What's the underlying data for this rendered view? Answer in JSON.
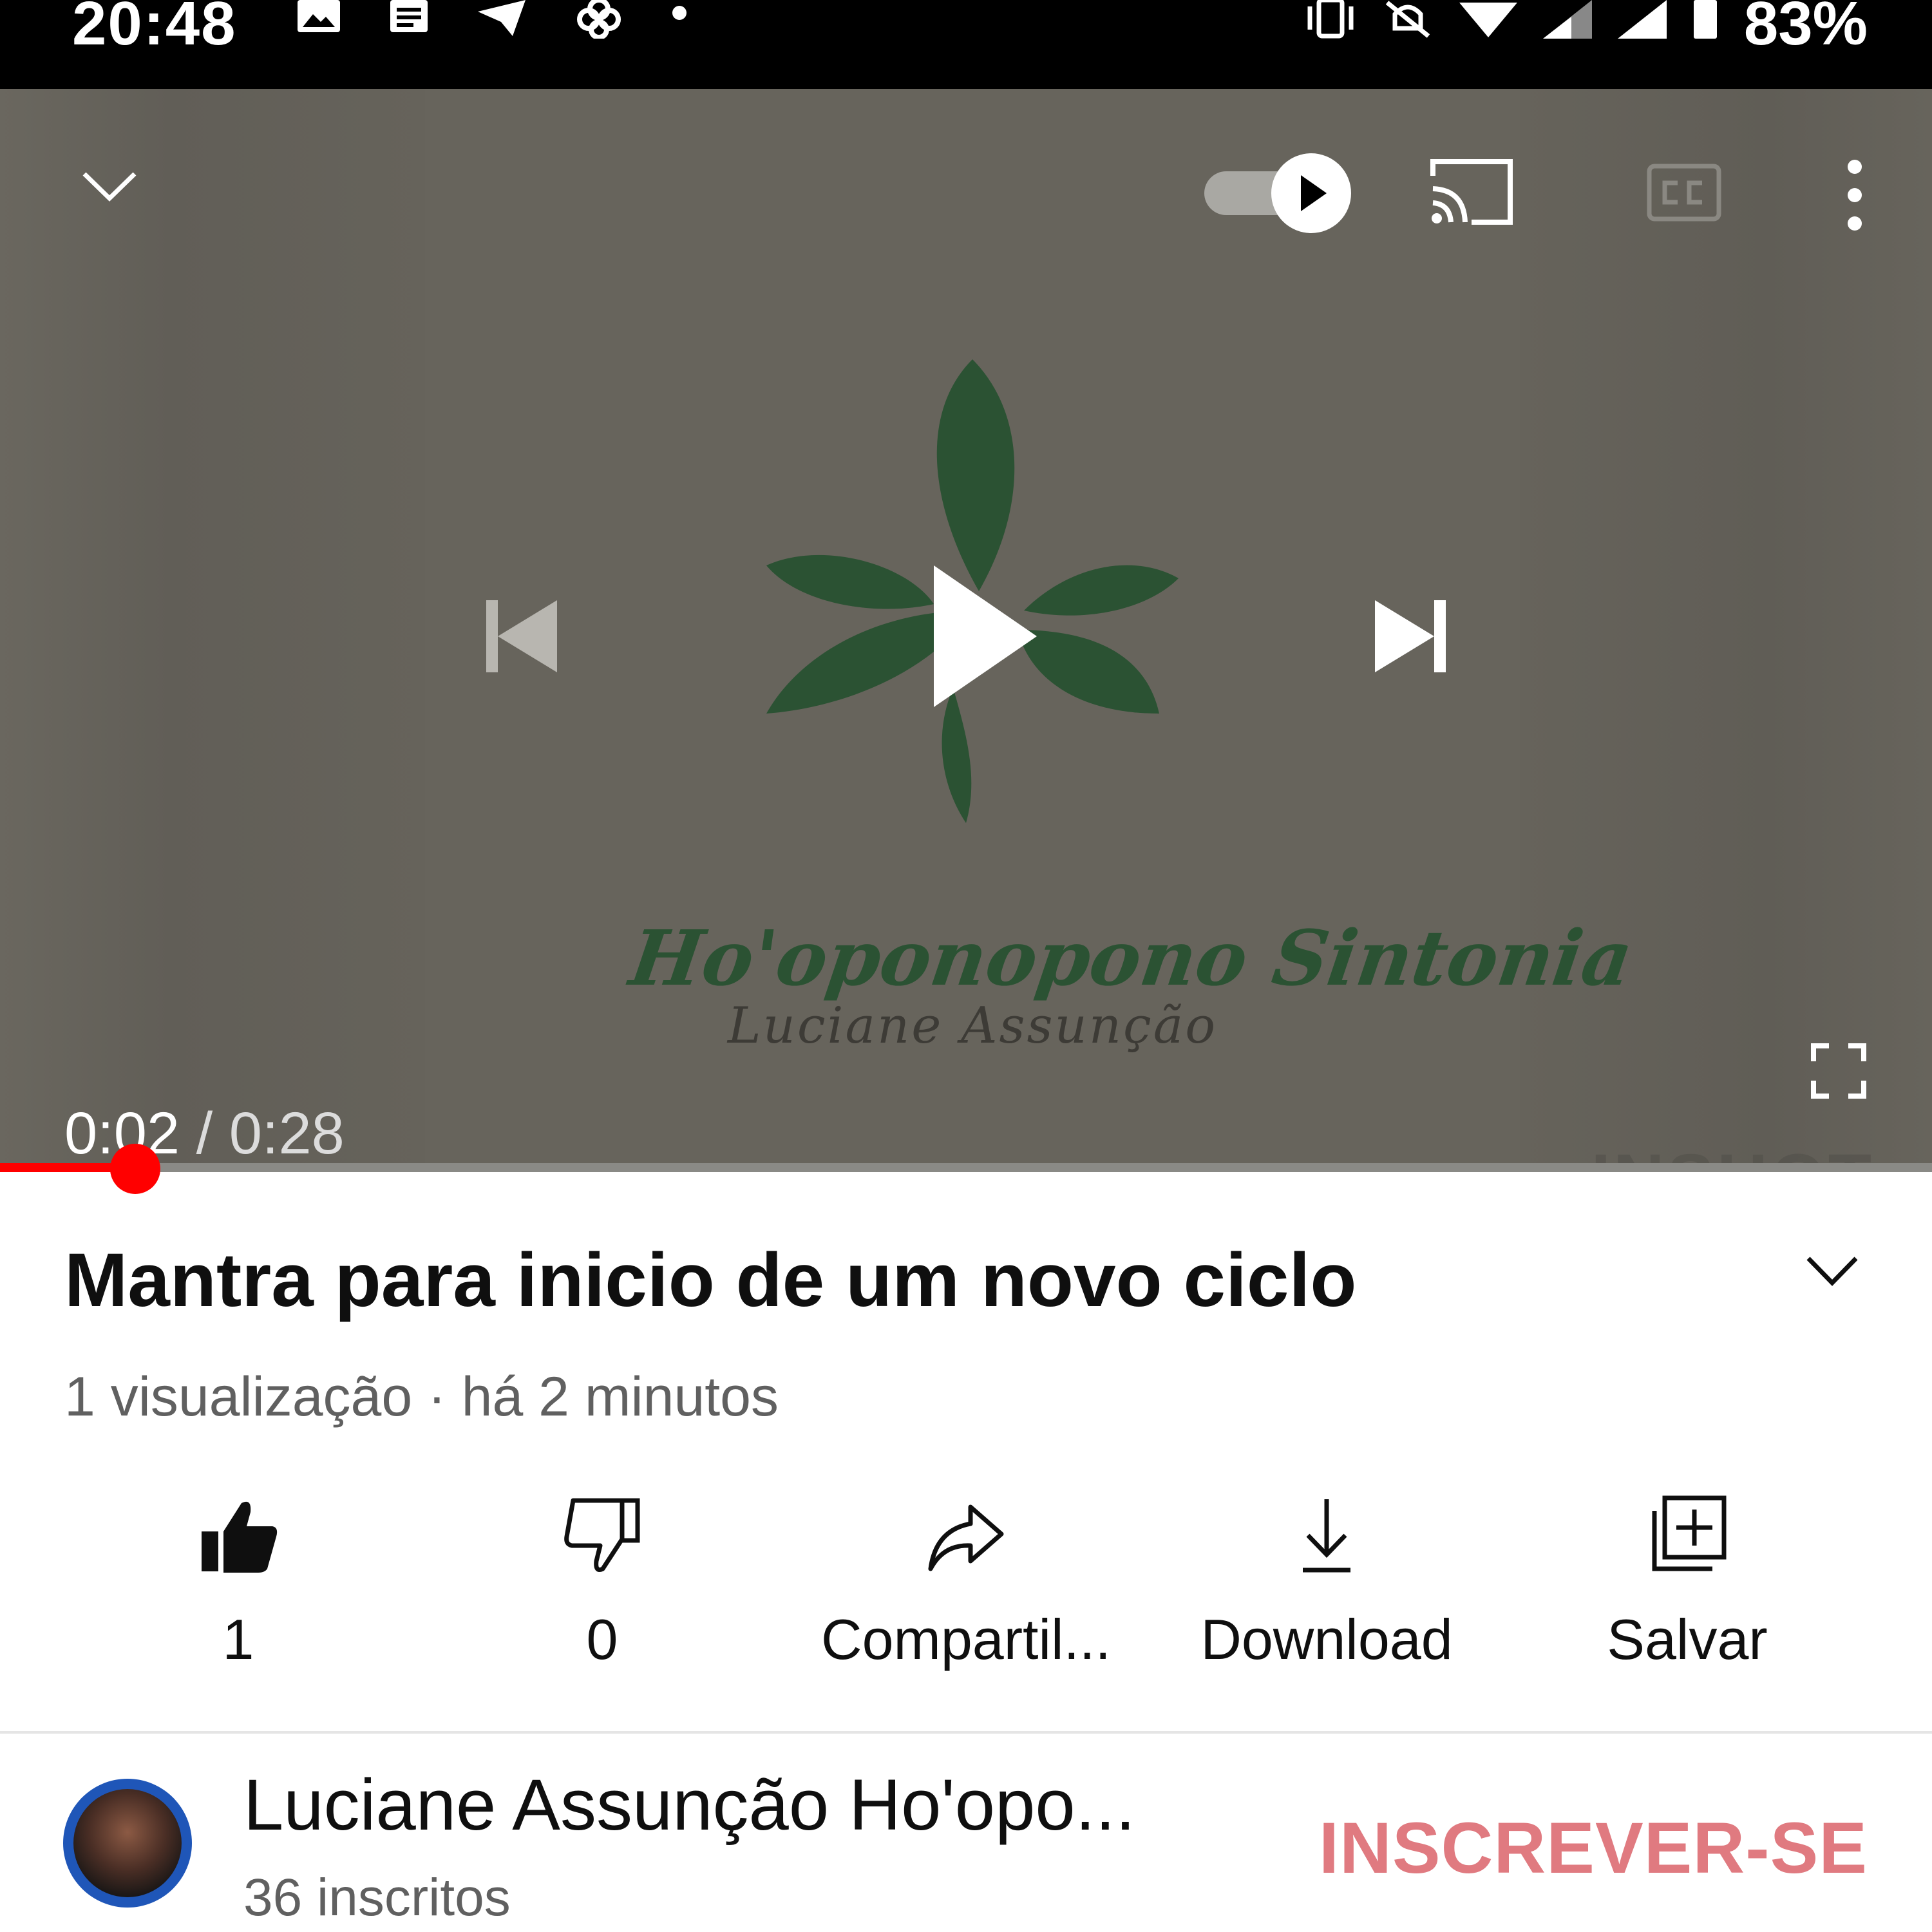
{
  "status_bar": {
    "time": "20:48",
    "battery": "83%"
  },
  "player": {
    "branding": {
      "script_title": "Ho'oponopono Sintonia",
      "author": "Luciane Assunção"
    },
    "time": {
      "current": "0:02",
      "separator": " / ",
      "duration": "0:28"
    },
    "watermark": "INSHOT",
    "progress_fraction": 0.07,
    "autoplay_on": true,
    "colors": {
      "background": "#67645c",
      "leaf": "#2b5233",
      "progress": "#ff0000"
    }
  },
  "video": {
    "title": "Mantra para inicio de um novo ciclo",
    "meta": "1 visualização · há 2 minutos"
  },
  "actions": [
    {
      "icon": "thumbs-up-filled-icon",
      "label": "1"
    },
    {
      "icon": "thumbs-down-icon",
      "label": "0"
    },
    {
      "icon": "share-icon",
      "label": "Compartil..."
    },
    {
      "icon": "download-icon",
      "label": "Download"
    },
    {
      "icon": "add-to-playlist-icon",
      "label": "Salvar"
    }
  ],
  "channel": {
    "name": "Luciane Assunção Ho'opo...",
    "subscribers": "36 inscritos",
    "subscribe_label": "INSCREVER-SE",
    "subscribe_color": "#e07a80"
  }
}
